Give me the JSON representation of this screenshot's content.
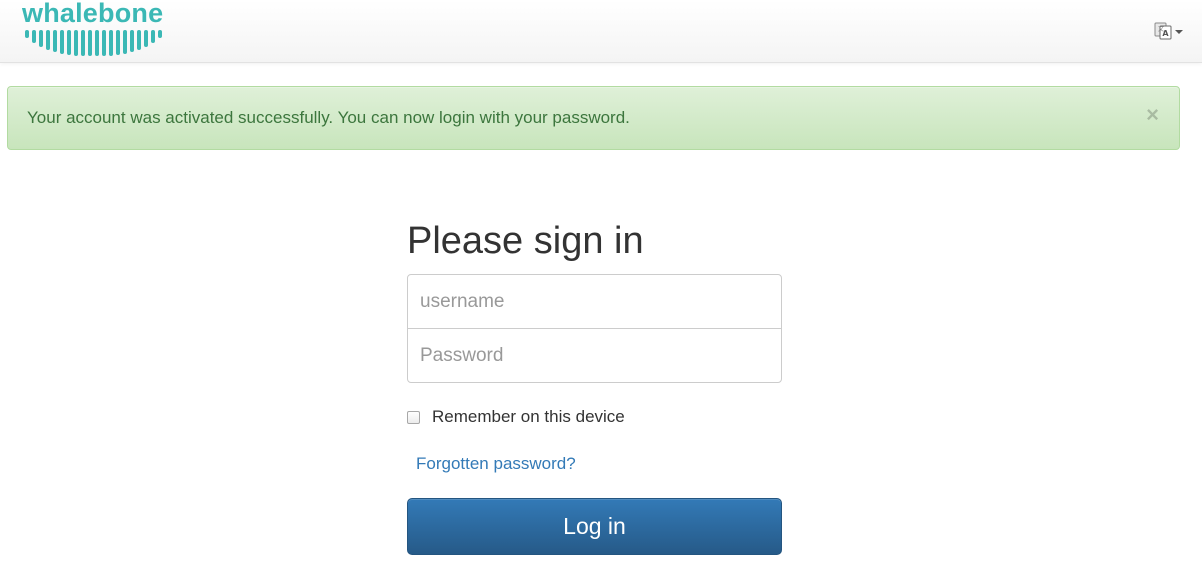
{
  "header": {
    "brand_name": "whalebone",
    "language_icon": "language-icon"
  },
  "alert": {
    "message": "Your account was activated successfully. You can now login with your password.",
    "close_label": "×",
    "colors": {
      "background": "#dff0d8",
      "border": "#b2dba1",
      "text": "#3c763d"
    }
  },
  "signin": {
    "heading": "Please sign in",
    "username_placeholder": "username",
    "username_value": "",
    "password_placeholder": "Password",
    "password_value": "",
    "remember_label": "Remember on this device",
    "remember_checked": false,
    "forgot_label": "Forgotten password?",
    "login_label": "Log in"
  },
  "colors": {
    "brand": "#3bb8b5",
    "primary_button": "#337ab7",
    "link": "#337ab7"
  }
}
